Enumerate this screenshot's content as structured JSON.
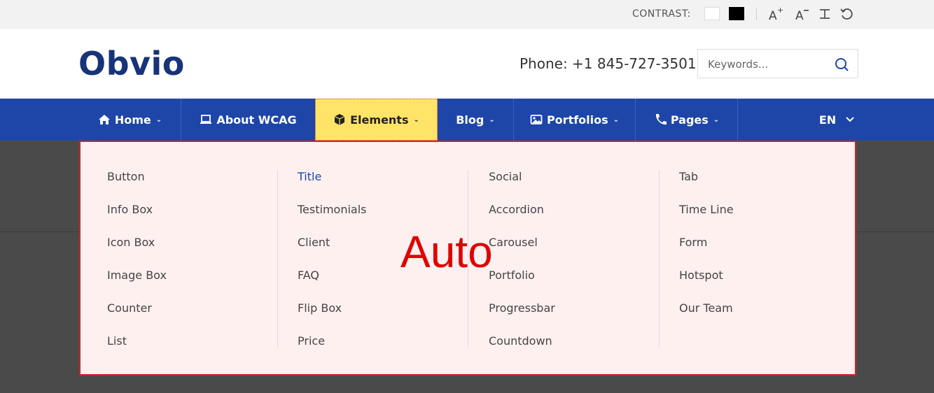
{
  "topbar": {
    "contrast_label": "CONTRAST:",
    "swatches": [
      {
        "name": "white",
        "color": "#ffffff"
      },
      {
        "name": "black",
        "color": "#000000"
      }
    ],
    "tools": [
      "font-increase-icon",
      "font-decrease-icon",
      "text-spacing-icon",
      "reset-icon"
    ]
  },
  "header": {
    "logo": "Obvio",
    "phone": "Phone: +1 845-727-3501",
    "search_placeholder": "Keywords..."
  },
  "nav": {
    "items": [
      {
        "label": "Home",
        "icon": "home-icon",
        "dropdown": true
      },
      {
        "label": "About WCAG",
        "icon": "laptop-icon",
        "dropdown": false
      },
      {
        "label": "Elements",
        "icon": "box-icon",
        "dropdown": true,
        "active": true
      },
      {
        "label": "Blog",
        "icon": "",
        "dropdown": true
      },
      {
        "label": "Portfolios",
        "icon": "image-icon",
        "dropdown": true
      },
      {
        "label": "Pages",
        "icon": "phone-icon",
        "dropdown": true
      }
    ],
    "language": "EN",
    "colors": {
      "nav_bg": "#1d46a8",
      "active_bg": "#ffe468",
      "brand": "#17337a"
    }
  },
  "mega_menu": {
    "columns": [
      [
        "Button",
        "Info Box",
        "Icon Box",
        "Image Box",
        "Counter",
        "List"
      ],
      [
        "Title",
        "Testimonials",
        "Client",
        "FAQ",
        "Flip Box",
        "Price"
      ],
      [
        "Social",
        "Accordion",
        "Carousel",
        "Portfolio",
        "Progressbar",
        "Countdown"
      ],
      [
        "Tab",
        "Time Line",
        "Form",
        "Hotspot",
        "Our Team"
      ]
    ],
    "current": "Title"
  },
  "overlay": {
    "text": "Auto"
  }
}
